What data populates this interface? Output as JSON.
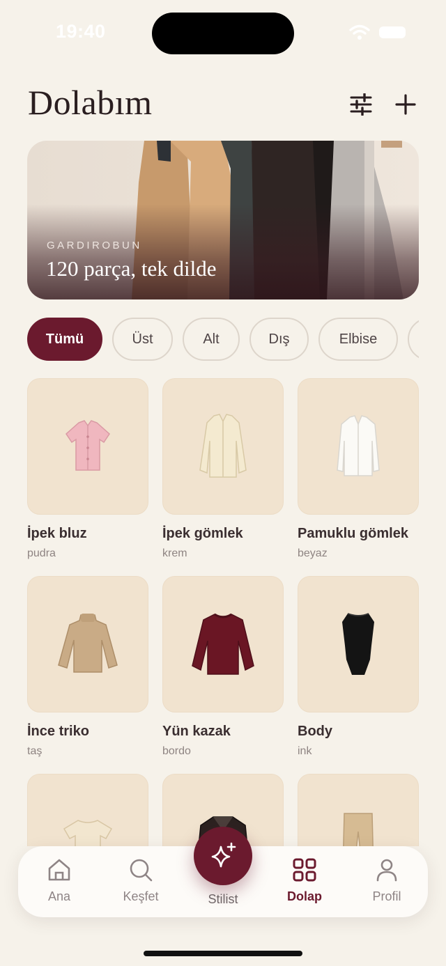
{
  "status": {
    "time": "19:40"
  },
  "header": {
    "title": "Dolabım"
  },
  "hero": {
    "kicker": "GARDIROBUN",
    "title": "120 parça, tek dilde"
  },
  "filters": [
    {
      "label": "Tümü",
      "active": true
    },
    {
      "label": "Üst",
      "active": false
    },
    {
      "label": "Alt",
      "active": false
    },
    {
      "label": "Dış",
      "active": false
    },
    {
      "label": "Elbise",
      "active": false
    },
    {
      "label": "",
      "active": false
    }
  ],
  "items": [
    {
      "name": "İpek bluz",
      "color": "pudra",
      "icon": "blouse-icon",
      "swatch": "#f0b7bf"
    },
    {
      "name": "İpek gömlek",
      "color": "krem",
      "icon": "shirt-icon",
      "swatch": "#f4ead0"
    },
    {
      "name": "Pamuklu gömlek",
      "color": "beyaz",
      "icon": "shirt-icon",
      "swatch": "#fbfaf6"
    },
    {
      "name": "İnce triko",
      "color": "taş",
      "icon": "sweater-icon",
      "swatch": "#c9ab86"
    },
    {
      "name": "Yün kazak",
      "color": "bordo",
      "icon": "sweater-icon",
      "swatch": "#6a1624"
    },
    {
      "name": "Body",
      "color": "ink",
      "icon": "bodysuit-icon",
      "swatch": "#141414"
    },
    {
      "name": "",
      "color": "",
      "icon": "tshirt-icon",
      "swatch": "#f2e6cf"
    },
    {
      "name": "",
      "color": "",
      "icon": "jacket-icon",
      "swatch": "#2b2220"
    },
    {
      "name": "",
      "color": "",
      "icon": "trousers-icon",
      "swatch": "#d6bb93"
    }
  ],
  "tabs": [
    {
      "label": "Ana",
      "icon": "home-icon",
      "active": false
    },
    {
      "label": "Keşfet",
      "icon": "search-icon",
      "active": false
    },
    {
      "label": "Stilist",
      "icon": "sparkle-icon",
      "active": false
    },
    {
      "label": "Dolap",
      "icon": "grid-icon",
      "active": true
    },
    {
      "label": "Profil",
      "icon": "user-icon",
      "active": false
    }
  ],
  "colors": {
    "accent": "#6b1a2e",
    "background": "#f6f2ea",
    "card": "#f1e3cf"
  }
}
